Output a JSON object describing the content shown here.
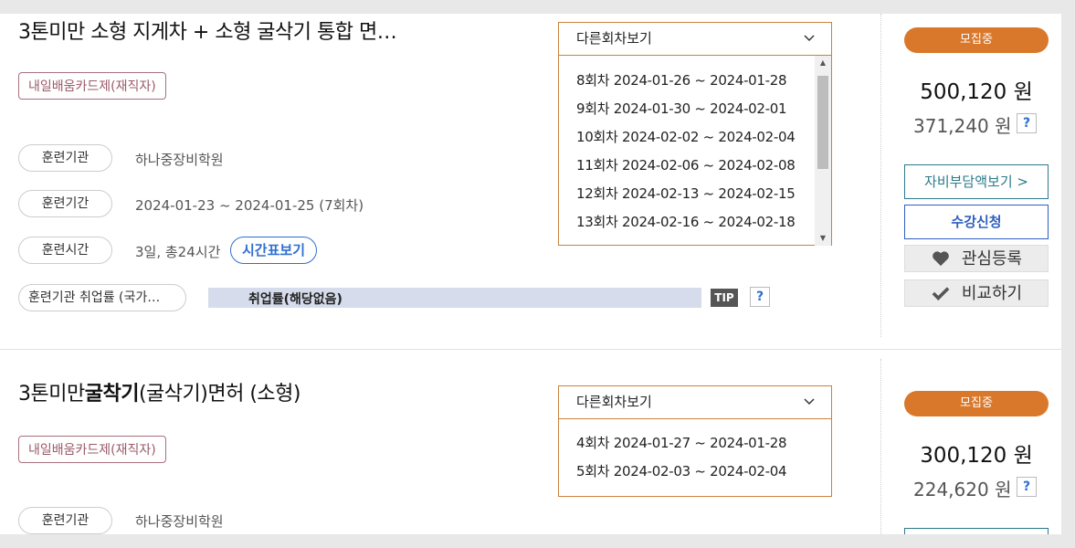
{
  "courses": [
    {
      "title": "3톤미만 소형 지게차 + 소형 굴삭기 통합 면…",
      "tag": "내일배움카드제(재직자)",
      "rows": [
        {
          "label": "훈련기관",
          "value": "하나중장비학원"
        },
        {
          "label": "훈련기간",
          "value": "2024-01-23 ~ 2024-01-25 (7회차)"
        },
        {
          "label": "훈련시간",
          "value": "3일, 총24시간"
        },
        {
          "label": "훈련기관 취업률 (국가…"
        }
      ],
      "timetable_label": "시간표보기",
      "employment_text": "취업률(해당없음)",
      "tip_label": "TIP",
      "help_label": "?",
      "dropdown": {
        "label": "다른회차보기",
        "items": [
          "8회차 2024-01-26 ~ 2024-01-28",
          "9회차 2024-01-30 ~ 2024-02-01",
          "10회차 2024-02-02 ~ 2024-02-04",
          "11회차 2024-02-06 ~ 2024-02-08",
          "12회차 2024-02-13 ~ 2024-02-15",
          "13회차 2024-02-16 ~ 2024-02-18"
        ]
      },
      "status": "모집중",
      "price": "500,120 원",
      "sub_price": "371,240 원",
      "self_pay_label": "자비부담액보기 >",
      "enroll_label": "수강신청",
      "wish_label": "관심등록",
      "compare_label": "비교하기"
    },
    {
      "title_prefix": "3톤미만",
      "title_bold": "굴착기",
      "title_suffix": "(굴삭기)면허 (소형)",
      "tag": "내일배움카드제(재직자)",
      "rows": [
        {
          "label": "훈련기관",
          "value": "하나중장비학원"
        }
      ],
      "help_label": "?",
      "dropdown": {
        "label": "다른회차보기",
        "items": [
          "4회차 2024-01-27 ~ 2024-01-28",
          "5회차 2024-02-03 ~ 2024-02-04"
        ]
      },
      "status": "모집중",
      "price": "300,120 원",
      "sub_price": "224,620 원"
    }
  ],
  "colors": {
    "status_orange": "#d9782a",
    "dropdown_border": "#c8823c",
    "link_blue": "#2f6fd0",
    "tag_border": "#a8707e"
  }
}
